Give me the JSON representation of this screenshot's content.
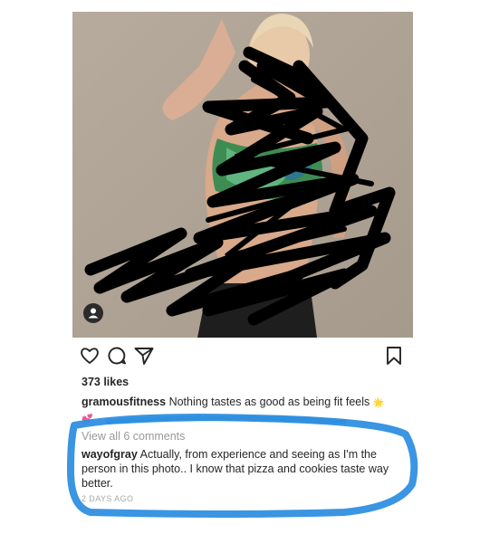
{
  "post": {
    "likes": "373 likes",
    "caption": {
      "username": "gramousfitness",
      "text": "Nothing tastes as good as being fit feels",
      "emoji": "🌟💕"
    },
    "view_comments": "View all 6 comments",
    "comment": {
      "username": "wayofgray",
      "text": "Actually, from experience and seeing as I'm the person in this photo.. I know that pizza and cookies taste way better."
    },
    "timestamp": "2 DAYS AGO"
  },
  "icons": {
    "like": "heart-icon",
    "comment": "comment-icon",
    "share": "share-icon",
    "save": "bookmark-icon",
    "user_tag": "person-icon"
  },
  "colors": {
    "scribble": "#000000",
    "highlight": "#2f8fe0",
    "muted_text": "#999999"
  }
}
